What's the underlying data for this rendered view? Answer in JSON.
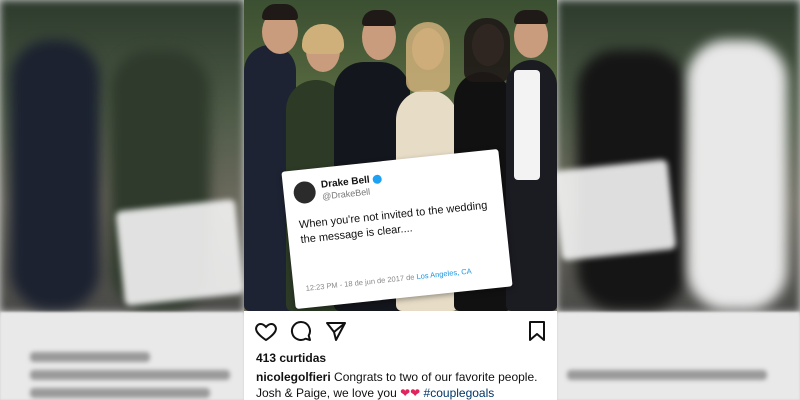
{
  "post": {
    "likes_text": "413 curtidas",
    "caption_user": "nicolegolfieri",
    "caption_text_1": "Congrats to two of our favorite people.",
    "caption_text_2": "Josh & Paige, we love you",
    "caption_hearts": "❤❤",
    "caption_hashtag": "#couplegoals"
  },
  "tweet": {
    "name": "Drake Bell",
    "handle": "@DrakeBell",
    "body": "When you're not invited to the wedding the message is clear....",
    "timestamp": "12:23 PM - 18 de jun de 2017 de",
    "location": "Los Angeles, CA"
  },
  "icons": {
    "like": "heart-outline-icon",
    "comment": "speech-bubble-icon",
    "share": "paper-plane-icon",
    "save": "bookmark-icon",
    "verified": "verified-badge-icon"
  },
  "colors": {
    "hashtag": "#003569",
    "verified": "#1da1f2",
    "location": "#1b95e0"
  }
}
